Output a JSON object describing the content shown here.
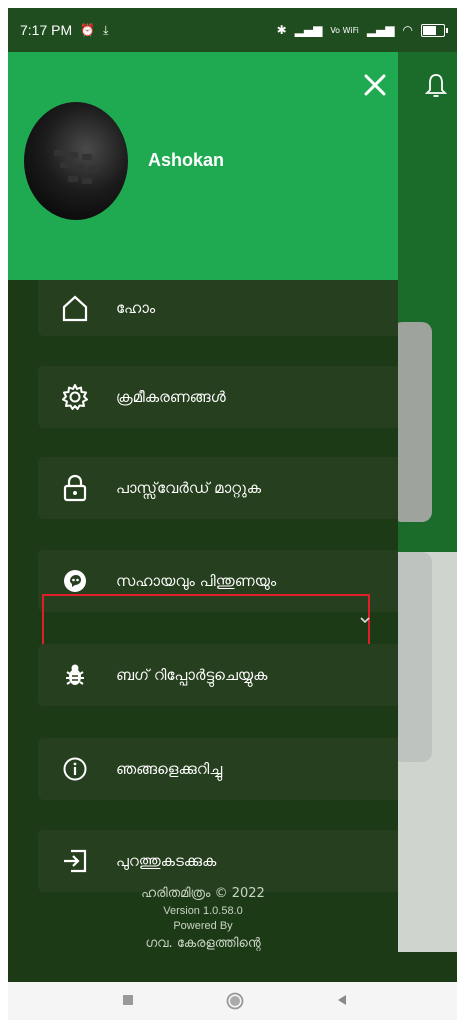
{
  "status_bar": {
    "time": "7:17 PM",
    "right_text": "Vo WiFi",
    "battery_level": "61"
  },
  "drawer": {
    "username": "Ashokan",
    "menu": [
      {
        "label": "ഹോം",
        "icon": "home-icon"
      },
      {
        "label": "ക്രമീകരണങ്ങൾ",
        "icon": "settings-icon"
      },
      {
        "label": "പാസ്സ്‌വേർഡ് മാറ്റുക",
        "icon": "lock-icon"
      },
      {
        "label": "സഹായവും പിന്തുണയും",
        "icon": "support-icon"
      },
      {
        "label": "ബഗ് റിപ്പോർട്ടുചെയ്യുക",
        "icon": "bug-icon"
      },
      {
        "label": "ഞങ്ങളെക്കുറിച്ചു",
        "icon": "info-icon"
      },
      {
        "label": "പുറത്തുകടക്കുക",
        "icon": "logout-icon"
      }
    ],
    "footer": {
      "line1": "ഹരിതമിത്രം © 2022",
      "line2": "Version 1.0.58.0",
      "line3": "Powered By",
      "line4": "ഗവ. കേരളത്തിന്റെ"
    }
  },
  "colors": {
    "header_green": "#1faa52",
    "drawer_bg": "#1d3a17",
    "item_bg": "#263f1e",
    "highlight": "#e01e2a"
  }
}
